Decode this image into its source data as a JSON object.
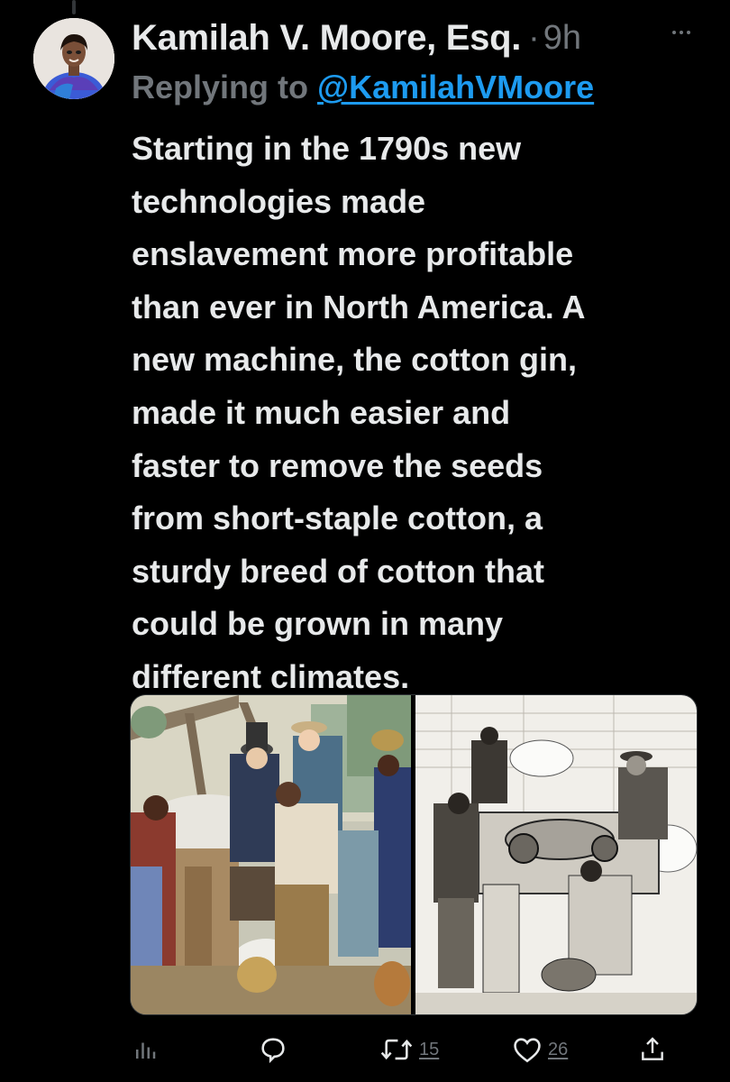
{
  "tweet": {
    "author_name": "Kamilah V. Moore, Esq.",
    "separator": "·",
    "time": "9h",
    "reply_prefix": "Replying to",
    "reply_handle": "@KamilahVMoore",
    "text_lines": [
      "Starting in the 1790s new",
      "technologies made",
      "enslavement more profitable",
      "than ever in North America. A",
      "new machine, the cotton gin,",
      "made it much easier and",
      "faster to remove the seeds",
      "from short-staple cotton, a",
      "sturdy breed of cotton that",
      "could be grown in many",
      "different climates."
    ],
    "media": [
      {
        "kind": "color-engraving",
        "icon": "image"
      },
      {
        "kind": "black-white-engraving",
        "icon": "image"
      }
    ]
  },
  "actions": {
    "analytics": {
      "icon": "analytics-icon"
    },
    "reply": {
      "icon": "reply-icon"
    },
    "retweet": {
      "icon": "retweet-icon",
      "count": "15"
    },
    "like": {
      "icon": "heart-icon",
      "count": "26"
    },
    "share": {
      "icon": "share-icon"
    }
  },
  "colors": {
    "background": "#000000",
    "text_primary": "#e7e9ea",
    "text_secondary": "#71767b",
    "link": "#1d9bf0"
  }
}
